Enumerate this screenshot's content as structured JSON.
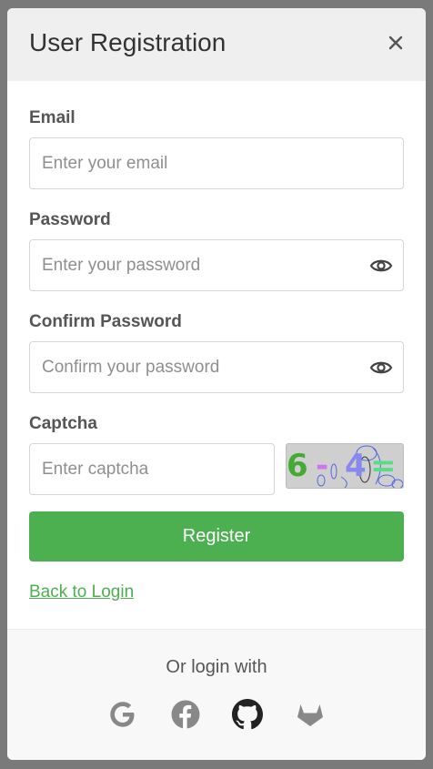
{
  "modal": {
    "title": "User Registration",
    "close_icon": "close-icon"
  },
  "form": {
    "email": {
      "label": "Email",
      "placeholder": "Enter your email",
      "value": ""
    },
    "password": {
      "label": "Password",
      "placeholder": "Enter your password",
      "value": "",
      "toggle_icon": "eye-icon"
    },
    "confirm_password": {
      "label": "Confirm Password",
      "placeholder": "Confirm your password",
      "value": "",
      "toggle_icon": "eye-icon"
    },
    "captcha": {
      "label": "Captcha",
      "placeholder": "Enter captcha",
      "value": "",
      "image_text": "6 - 4 ="
    },
    "register_label": "Register",
    "back_link": "Back to Login"
  },
  "footer": {
    "text": "Or login with",
    "providers": [
      "google-icon",
      "facebook-icon",
      "github-icon",
      "gitlab-icon"
    ]
  },
  "colors": {
    "accent": "#4caf50",
    "header_bg": "#efefef",
    "overlay": "#7a7a7a"
  }
}
